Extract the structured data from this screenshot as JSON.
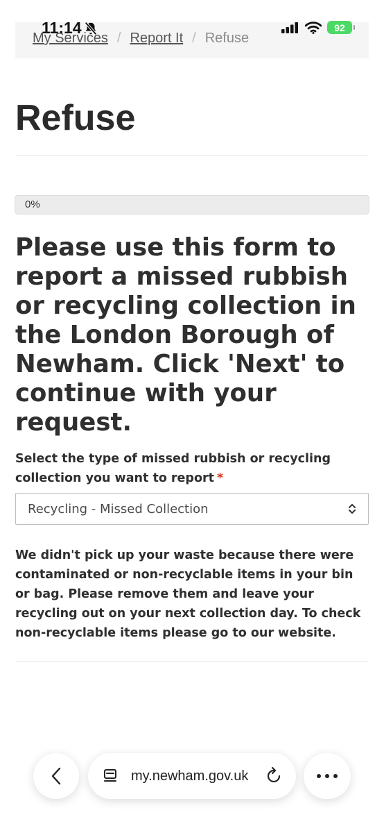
{
  "status_bar": {
    "time": "11:14",
    "battery": "92"
  },
  "breadcrumb": {
    "items": [
      "My Services",
      "Report It"
    ],
    "current": "Refuse"
  },
  "page": {
    "title": "Refuse"
  },
  "progress": {
    "value_percent": 0,
    "label": "0%"
  },
  "form": {
    "intro": "Please use this form to report a missed rubbish or recycling collection in the London Borough of Newham. Click 'Next' to continue with your request.",
    "type_label": "Select the type of missed rubbish or recycling collection you want to report",
    "required_mark": "*",
    "type_selected": "Recycling - Missed Collection",
    "info": "We didn't pick up your waste because there were contaminated or non-recyclable items in your bin or bag. Please remove them and leave your recycling out on your next collection day. To check non-recyclable items please go to our website."
  },
  "browser": {
    "url": "my.newham.gov.uk"
  },
  "colors": {
    "accent_required": "#d4351c",
    "battery": "#4cd964"
  }
}
